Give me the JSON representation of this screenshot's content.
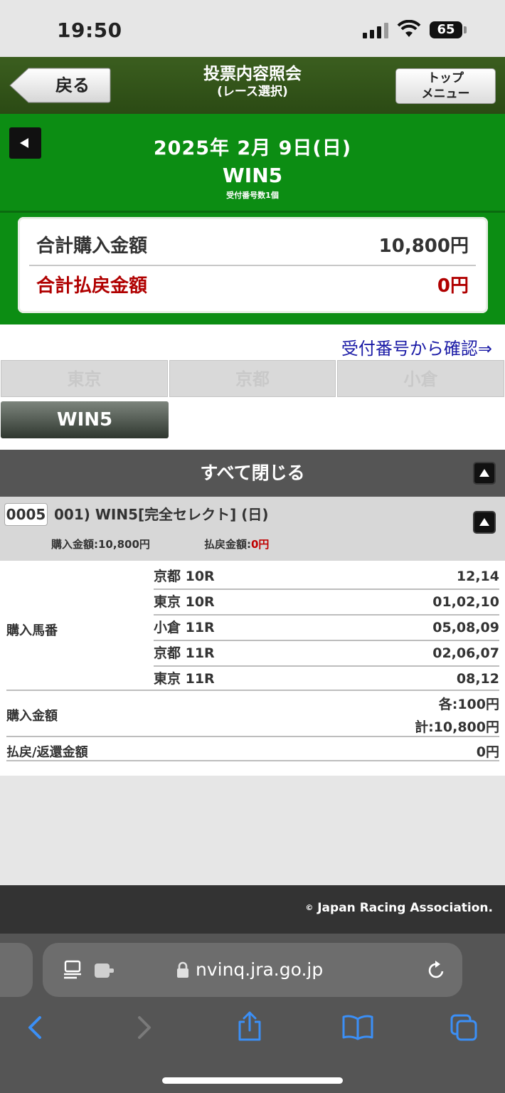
{
  "status_bar": {
    "time": "19:50",
    "battery": "65"
  },
  "header": {
    "back_label": "戻る",
    "title": "投票内容照会",
    "subtitle": "(レース選択)",
    "top_menu_line1": "トップ",
    "top_menu_line2": "メニュー"
  },
  "date_section": {
    "date": "2025年 2月 9日(日)",
    "bet_type": "WIN5",
    "receipt_count": "受付番号数1個"
  },
  "summary": {
    "purchase_label": "合計購入金額",
    "purchase_value": "10,800円",
    "payout_label": "合計払戻金額",
    "payout_value": "0円"
  },
  "confirm_link": "受付番号から確認⇒",
  "venue_tabs": [
    "東京",
    "京都",
    "小倉"
  ],
  "selected_tab": "WIN5",
  "close_all_label": "すべて閉じる",
  "ticket": {
    "number": "0005",
    "title": "001) WIN5[完全セレクト] (日)",
    "purchase_amount_label": "購入金額:",
    "purchase_amount": "10,800円",
    "payout_amount_label": "払戻金額:",
    "payout_amount": "0円"
  },
  "details": {
    "horses_label": "購入馬番",
    "races": [
      {
        "race": "京都 10R",
        "numbers": "12,14"
      },
      {
        "race": "東京 10R",
        "numbers": "01,02,10"
      },
      {
        "race": "小倉 11R",
        "numbers": "05,08,09"
      },
      {
        "race": "京都 11R",
        "numbers": "02,06,07"
      },
      {
        "race": "東京 11R",
        "numbers": "08,12"
      }
    ],
    "amount_label": "購入金額",
    "amount_each": "各:100円",
    "amount_total": "計:10,800円",
    "refund_label": "払戻/返還金額",
    "refund_value": "0円"
  },
  "footer": {
    "copyright": "Japan Racing Association."
  },
  "browser": {
    "url": "nvinq.jra.go.jp"
  },
  "colors": {
    "green": "#0c8d13",
    "header_dark_green": "#2b4a14",
    "red": "#c00000",
    "link_blue": "#1a1aa6",
    "ios_blue": "#3b8ff6"
  }
}
